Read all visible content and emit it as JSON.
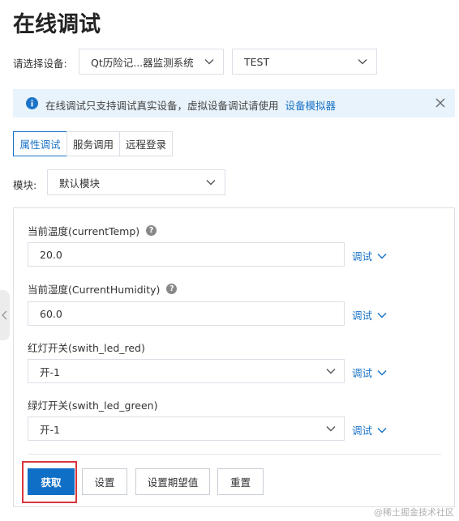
{
  "page": {
    "title": "在线调试"
  },
  "device": {
    "label": "请选择设备:",
    "product_value": "Qt历险记...器监测系统",
    "device_value": "TEST"
  },
  "alert": {
    "message": "在线调试只支持调试真实设备，虚拟设备调试请使用",
    "link_text": "设备模拟器"
  },
  "tabs": [
    {
      "label": "属性调试",
      "active": true
    },
    {
      "label": "服务调用",
      "active": false
    },
    {
      "label": "远程登录",
      "active": false
    }
  ],
  "module": {
    "label": "模块:",
    "value": "默认模块"
  },
  "fields": [
    {
      "label": "当前温度(currentTemp)",
      "value": "20.0",
      "type": "input",
      "has_help": true,
      "action": "调试"
    },
    {
      "label": "当前湿度(CurrentHumidity)",
      "value": "60.0",
      "type": "input",
      "has_help": true,
      "action": "调试"
    },
    {
      "label": "红灯开关(swith_led_red)",
      "value": "开-1",
      "type": "select",
      "has_help": false,
      "action": "调试"
    },
    {
      "label": "绿灯开关(swith_led_green)",
      "value": "开-1",
      "type": "select",
      "has_help": false,
      "action": "调试"
    }
  ],
  "buttons": {
    "get": "获取",
    "set": "设置",
    "set_expected": "设置期望值",
    "reset": "重置"
  },
  "help_glyph": "?",
  "watermark": "@稀土掘金技术社区",
  "colors": {
    "accent": "#1a73c8",
    "primary_button": "#0f6fc6",
    "highlight": "#d9363e",
    "alert_bg": "#e9f3fb"
  }
}
